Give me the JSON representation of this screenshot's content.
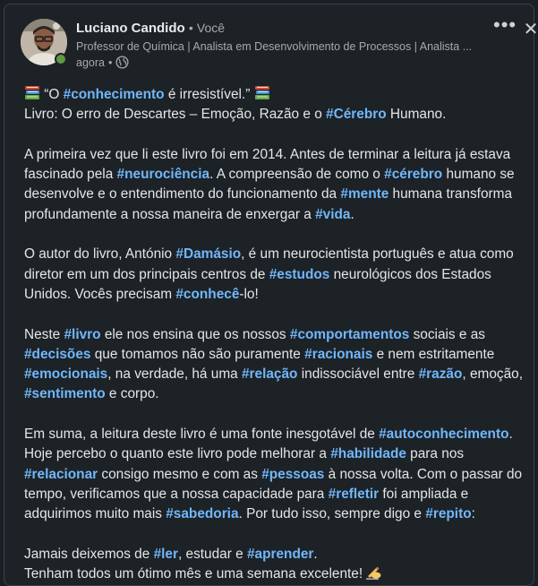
{
  "author": {
    "name": "Luciano Candido",
    "separator": "•",
    "relation": "Você",
    "headline": "Professor de Química | Analista em Desenvolvimento de Processos | Analista ...",
    "time": "agora",
    "time_separator": "•"
  },
  "controls": {
    "more": "•••",
    "close": "✕"
  },
  "icons": {
    "globe": "globe-icon",
    "books": "books-icon",
    "writing_hand": "writing-hand-icon",
    "more": "more-options-icon",
    "close": "close-icon"
  },
  "colors": {
    "background": "#1d2226",
    "hashtag": "#71b7fb",
    "text": "#e4e6e8",
    "secondary_text": "#a8aaab",
    "presence": "#5f9b41"
  },
  "post": {
    "paragraphs": [
      {
        "lines": [
          [
            {
              "t": "“O "
            },
            {
              "h": "#conhecimento"
            },
            {
              "t": " é irresistível.”"
            }
          ],
          [
            {
              "t": "Livro: O erro de Descartes – Emoção, Razão e o "
            },
            {
              "h": "#Cérebro"
            },
            {
              "t": " Humano."
            }
          ]
        ]
      },
      {
        "lines": [
          [
            {
              "t": "A primeira vez que li este livro foi em 2014. Antes de terminar a leitura já estava"
            }
          ],
          [
            {
              "t": "fascinado pela "
            },
            {
              "h": "#neurociência"
            },
            {
              "t": ". A compreensão de como o "
            },
            {
              "h": "#cérebro"
            },
            {
              "t": " humano se"
            }
          ],
          [
            {
              "t": "desenvolve e o entendimento do funcionamento da "
            },
            {
              "h": "#mente"
            },
            {
              "t": " humana transforma"
            }
          ],
          [
            {
              "t": "profundamente a nossa maneira de enxergar a "
            },
            {
              "h": "#vida"
            },
            {
              "t": "."
            }
          ]
        ]
      },
      {
        "lines": [
          [
            {
              "t": "O autor do livro, António "
            },
            {
              "h": "#Damásio"
            },
            {
              "t": ", é um neurocientista português e atua como"
            }
          ],
          [
            {
              "t": "diretor em um dos principais centros de "
            },
            {
              "h": "#estudos"
            },
            {
              "t": " neurológicos dos Estados"
            }
          ],
          [
            {
              "t": "Unidos. Vocês precisam "
            },
            {
              "h": "#conhecê"
            },
            {
              "t": "-lo!"
            }
          ]
        ]
      },
      {
        "lines": [
          [
            {
              "t": "Neste "
            },
            {
              "h": "#livro"
            },
            {
              "t": " ele nos ensina que os nossos "
            },
            {
              "h": "#comportamentos"
            },
            {
              "t": " sociais e as"
            }
          ],
          [
            {
              "h": "#decisões"
            },
            {
              "t": " que tomamos não são puramente "
            },
            {
              "h": "#racionais"
            },
            {
              "t": " e nem estritamente"
            }
          ],
          [
            {
              "h": "#emocionais"
            },
            {
              "t": ", na verdade, há uma "
            },
            {
              "h": "#relação"
            },
            {
              "t": " indissociável entre "
            },
            {
              "h": "#razão"
            },
            {
              "t": ", emoção,"
            }
          ],
          [
            {
              "h": "#sentimento"
            },
            {
              "t": " e corpo."
            }
          ]
        ]
      },
      {
        "lines": [
          [
            {
              "t": "Em suma, a leitura deste livro é uma fonte inesgotável de "
            },
            {
              "h": "#autoconhecimento"
            },
            {
              "t": "."
            }
          ],
          [
            {
              "t": "Hoje percebo o quanto este livro pode melhorar a "
            },
            {
              "h": "#habilidade"
            },
            {
              "t": " para nos"
            }
          ],
          [
            {
              "h": "#relacionar"
            },
            {
              "t": " consigo mesmo e com as "
            },
            {
              "h": "#pessoas"
            },
            {
              "t": " à nossa volta. Com o passar do"
            }
          ],
          [
            {
              "t": "tempo, verificamos que a nossa capacidade para "
            },
            {
              "h": "#refletir"
            },
            {
              "t": " foi ampliada e"
            }
          ],
          [
            {
              "t": "adquirimos muito mais "
            },
            {
              "h": "#sabedoria"
            },
            {
              "t": ". Por tudo isso, sempre digo e "
            },
            {
              "h": "#repito"
            },
            {
              "t": ":"
            }
          ]
        ]
      },
      {
        "lines": [
          [
            {
              "t": "Jamais deixemos de "
            },
            {
              "h": "#ler"
            },
            {
              "t": ", estudar e "
            },
            {
              "h": "#aprender"
            },
            {
              "t": "."
            }
          ],
          [
            {
              "t": "Tenham todos um ótimo mês e uma semana excelente! "
            }
          ]
        ]
      }
    ]
  }
}
